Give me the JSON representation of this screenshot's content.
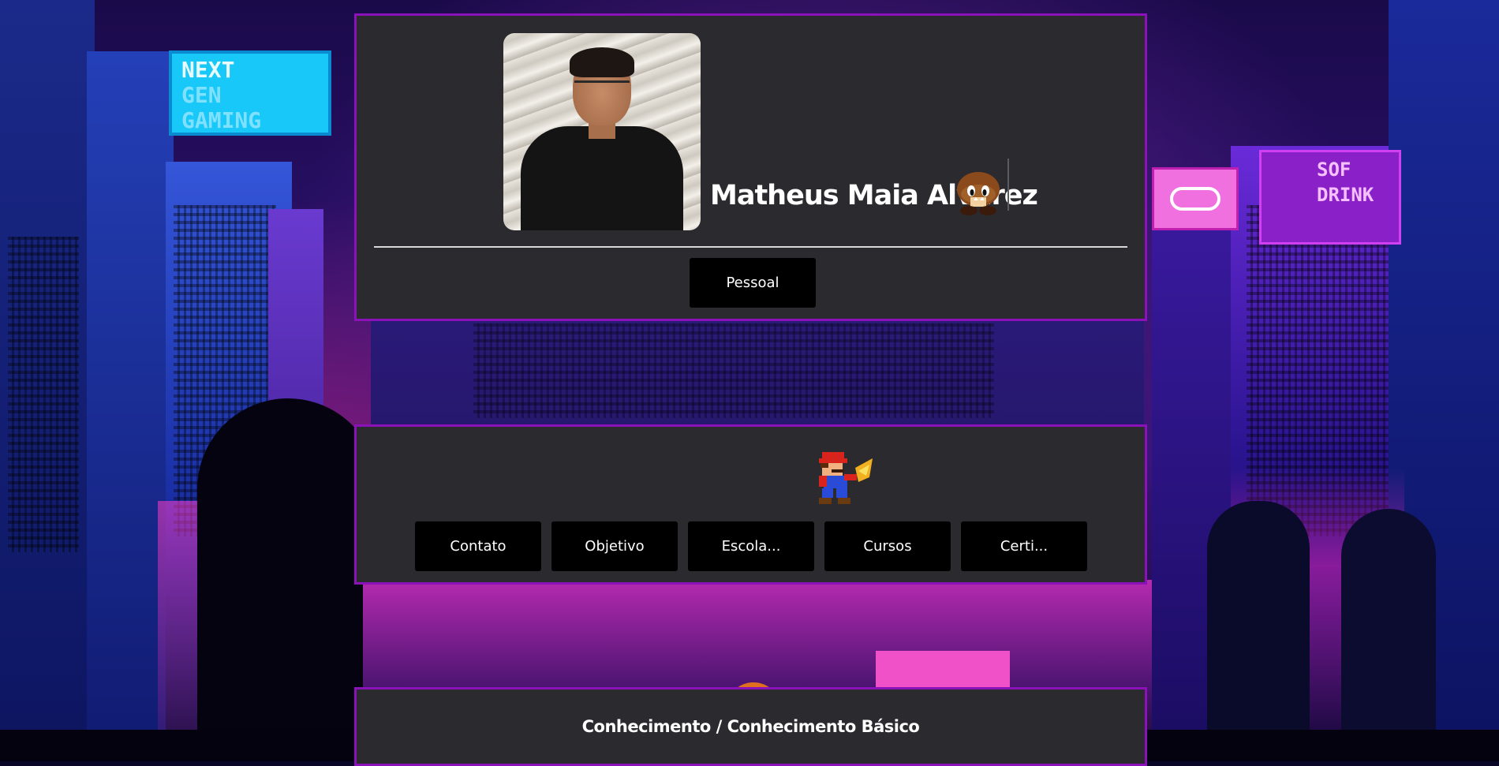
{
  "profile": {
    "name": "Matheus Maia Alvarez",
    "photo_alt": "",
    "tab_label": "Pessoal"
  },
  "sections": {
    "buttons": [
      {
        "label": "Contato"
      },
      {
        "label": "Objetivo"
      },
      {
        "label": "Escola..."
      },
      {
        "label": "Cursos"
      },
      {
        "label": "Certi..."
      }
    ]
  },
  "skills": {
    "title": "Conhecimento / Conhecimento Básico"
  },
  "background": {
    "sign_text": [
      "NEXT",
      "GEN",
      "GAMING"
    ],
    "drink_sign": [
      "SOF",
      "DRINK"
    ]
  },
  "colors": {
    "card_bg": "#2b2a2e",
    "card_border": "#8a12b8",
    "button_bg": "#000000",
    "text": "#ffffff"
  },
  "icons": {
    "name_icon": "goomba-icon",
    "sections_icon": "mario-icon"
  }
}
